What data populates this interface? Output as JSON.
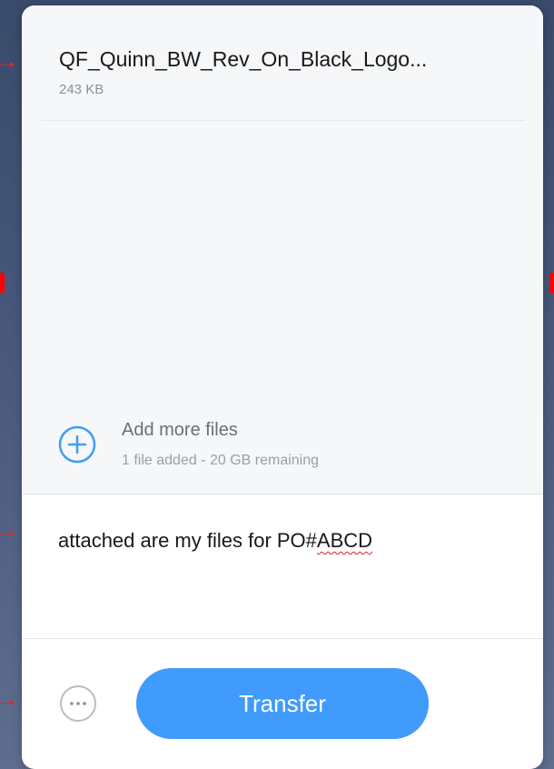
{
  "file": {
    "name": "QF_Quinn_BW_Rev_On_Black_Logo...",
    "size": "243 KB"
  },
  "add_files": {
    "label": "Add more files",
    "status": "1 file added - 20 GB remaining",
    "icon": "plus-circle-icon"
  },
  "message": {
    "text_prefix": "attached are my files for PO#",
    "text_misspelled": "ABCD"
  },
  "footer": {
    "more_icon": "ellipsis-circle-icon",
    "transfer_label": "Transfer"
  },
  "colors": {
    "accent": "#409bfc",
    "background": "#3a4a6b"
  }
}
